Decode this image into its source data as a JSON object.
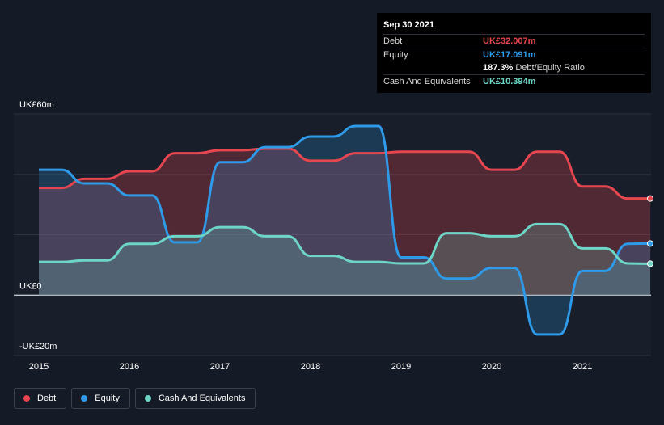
{
  "tooltip": {
    "date": "Sep 30 2021",
    "rows": [
      {
        "label": "Debt",
        "value": "UK£32.007m",
        "color": "#e5464f"
      },
      {
        "label": "Equity",
        "value": "UK£17.091m",
        "color": "#2e9ae8"
      },
      {
        "label": "",
        "value": "187.3%",
        "suffix": "Debt/Equity Ratio",
        "color": "#ffffff"
      },
      {
        "label": "Cash And Equivalents",
        "value": "UK£10.394m",
        "color": "#6dd6c6"
      }
    ]
  },
  "legend": [
    {
      "label": "Debt",
      "color": "#e5464f"
    },
    {
      "label": "Equity",
      "color": "#2e9ae8"
    },
    {
      "label": "Cash And Equivalents",
      "color": "#6dd6c6"
    }
  ],
  "chart_data": {
    "type": "area",
    "title": "",
    "xlabel": "",
    "ylabel": "",
    "ylim": [
      -20,
      60
    ],
    "y_ticks": [
      {
        "value": 60,
        "label": "UK£60m"
      },
      {
        "value": 0,
        "label": "UK£0"
      },
      {
        "value": -20,
        "label": "-UK£20m"
      }
    ],
    "x_ticks": [
      2015,
      2016,
      2017,
      2018,
      2019,
      2020,
      2021
    ],
    "xlim": [
      2015,
      2021.75
    ],
    "grid": true,
    "legend_position": "bottom-left",
    "series": [
      {
        "name": "Debt",
        "color": "#e5464f",
        "points": [
          [
            2015,
            35.5
          ],
          [
            2015.25,
            35.5
          ],
          [
            2015.5,
            38.5
          ],
          [
            2015.75,
            38.5
          ],
          [
            2016,
            41
          ],
          [
            2016.25,
            41
          ],
          [
            2016.5,
            47
          ],
          [
            2016.75,
            47
          ],
          [
            2017,
            48
          ],
          [
            2017.25,
            48
          ],
          [
            2017.5,
            48.5
          ],
          [
            2017.75,
            48.5
          ],
          [
            2018,
            44.5
          ],
          [
            2018.25,
            44.5
          ],
          [
            2018.5,
            47
          ],
          [
            2018.75,
            47
          ],
          [
            2019,
            47.5
          ],
          [
            2019.25,
            47.5
          ],
          [
            2019.5,
            47.5
          ],
          [
            2019.75,
            47.5
          ],
          [
            2020,
            41.5
          ],
          [
            2020.25,
            41.5
          ],
          [
            2020.5,
            47.5
          ],
          [
            2020.75,
            47.5
          ],
          [
            2021,
            36
          ],
          [
            2021.25,
            36
          ],
          [
            2021.5,
            32
          ],
          [
            2021.75,
            32.007
          ]
        ]
      },
      {
        "name": "Equity",
        "color": "#2e9ae8",
        "points": [
          [
            2015,
            41.5
          ],
          [
            2015.25,
            41.5
          ],
          [
            2015.5,
            37
          ],
          [
            2015.75,
            37
          ],
          [
            2016,
            33
          ],
          [
            2016.25,
            33
          ],
          [
            2016.5,
            17.5
          ],
          [
            2016.75,
            17.5
          ],
          [
            2017,
            44
          ],
          [
            2017.25,
            44
          ],
          [
            2017.5,
            49
          ],
          [
            2017.75,
            49
          ],
          [
            2018,
            52.5
          ],
          [
            2018.25,
            52.5
          ],
          [
            2018.5,
            56
          ],
          [
            2018.75,
            56
          ],
          [
            2019,
            12.5
          ],
          [
            2019.25,
            12.5
          ],
          [
            2019.5,
            5.5
          ],
          [
            2019.75,
            5.5
          ],
          [
            2020,
            9
          ],
          [
            2020.25,
            9
          ],
          [
            2020.5,
            -13
          ],
          [
            2020.75,
            -13
          ],
          [
            2021,
            8
          ],
          [
            2021.25,
            8
          ],
          [
            2021.5,
            17
          ],
          [
            2021.75,
            17.091
          ]
        ]
      },
      {
        "name": "Cash And Equivalents",
        "color": "#6dd6c6",
        "points": [
          [
            2015,
            11
          ],
          [
            2015.25,
            11
          ],
          [
            2015.5,
            11.5
          ],
          [
            2015.75,
            11.5
          ],
          [
            2016,
            17
          ],
          [
            2016.25,
            17
          ],
          [
            2016.5,
            19.5
          ],
          [
            2016.75,
            19.5
          ],
          [
            2017,
            22.5
          ],
          [
            2017.25,
            22.5
          ],
          [
            2017.5,
            19.5
          ],
          [
            2017.75,
            19.5
          ],
          [
            2018,
            13
          ],
          [
            2018.25,
            13
          ],
          [
            2018.5,
            11
          ],
          [
            2018.75,
            11
          ],
          [
            2019,
            10.5
          ],
          [
            2019.25,
            10.5
          ],
          [
            2019.5,
            20.5
          ],
          [
            2019.75,
            20.5
          ],
          [
            2020,
            19.5
          ],
          [
            2020.25,
            19.5
          ],
          [
            2020.5,
            23.5
          ],
          [
            2020.75,
            23.5
          ],
          [
            2021,
            15.5
          ],
          [
            2021.25,
            15.5
          ],
          [
            2021.5,
            10.5
          ],
          [
            2021.75,
            10.394
          ]
        ]
      }
    ]
  }
}
